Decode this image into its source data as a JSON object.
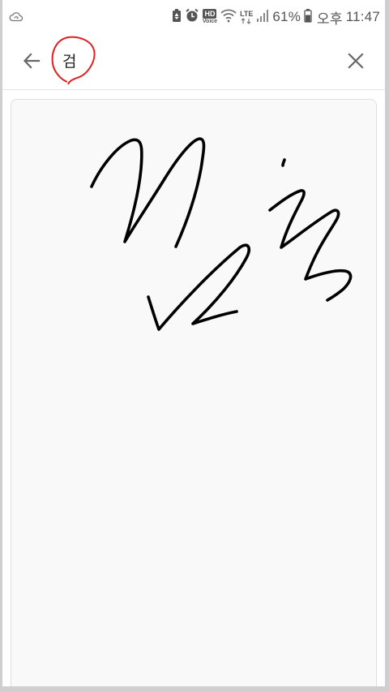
{
  "status_bar": {
    "battery_percent": "61%",
    "period": "오후",
    "time": "11:47",
    "hd_label": "HD",
    "voice_label": "Voice",
    "network_label": "LTE",
    "icons": [
      "cloud-sync-icon",
      "battery-saver-icon",
      "alarm-icon",
      "hd-voice-icon",
      "wifi-icon",
      "lte-icon",
      "signal-icon",
      "battery-icon"
    ]
  },
  "header": {
    "back_icon": "arrow-left-icon",
    "recognized_text": "검",
    "close_icon": "close-icon",
    "annotation_color": "#e02020"
  },
  "canvas": {
    "background": "#f9f9f9",
    "ink_color": "#000000"
  }
}
